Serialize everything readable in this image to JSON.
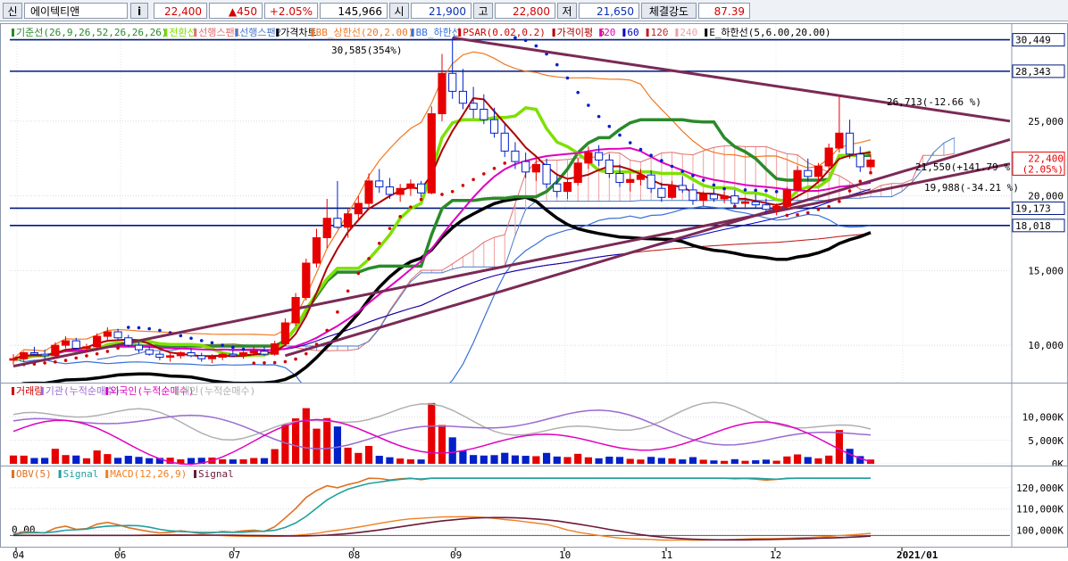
{
  "colors": {
    "up": "#e60000",
    "down": "#0020c8",
    "axis_line": "#001a80",
    "trend": "#7a2a55",
    "box_fill": "#ffffff",
    "box_stroke": "#001a80"
  },
  "toolbar": {
    "icon_left": "신",
    "stock_name": "에이텍티앤",
    "info_icon": "i",
    "price": "22,400",
    "change": "▲450",
    "change_pct": "+2.05%",
    "volume": "145,966",
    "open_label": "시",
    "open": "21,900",
    "high_label": "고",
    "high": "22,800",
    "low_label": "저",
    "low": "21,650",
    "strength_label": "체결강도",
    "strength": "87.39"
  },
  "price_legend": [
    {
      "text": "기준선(26,9,26,52,26,26,26)",
      "color": "#2a8a2a"
    },
    {
      "text": "전환선",
      "color": "#7ee000"
    },
    {
      "text": "선행스팬1",
      "color": "#e07070"
    },
    {
      "text": "선행스팬2",
      "color": "#4a7ac8"
    },
    {
      "text": "가격차트",
      "color": "#000000"
    },
    {
      "text": "BB_상한선(20,2.00)",
      "color": "#f07820"
    },
    {
      "text": "BB_하한선",
      "color": "#3870d8"
    },
    {
      "text": "PSAR(0.02,0.2)",
      "color": "#d00000"
    },
    {
      "text": "가격이평 5",
      "color": "#b00000"
    },
    {
      "text": "20",
      "color": "#e000c0"
    },
    {
      "text": "60",
      "color": "#0000c0"
    },
    {
      "text": "120",
      "color": "#c02020"
    },
    {
      "text": "240",
      "color": "#f0a0a0"
    },
    {
      "text": "E_하한선(5,6.00,20.00)",
      "color": "#000000"
    }
  ],
  "volume_legend": [
    {
      "text": "거래량",
      "color": "#d00000"
    },
    {
      "text": "기관(누적순매수)",
      "color": "#9b6ad0"
    },
    {
      "text": "외국인(누적순매수)",
      "color": "#e000c0"
    },
    {
      "text": "개인(누적순매수)",
      "color": "#b0b0b0"
    }
  ],
  "obv_legend": [
    {
      "text": "OBV(5)",
      "color": "#e07020"
    },
    {
      "text": "Signal",
      "color": "#20a0a0"
    },
    {
      "text": "MACD(12,26,9)",
      "color": "#f08020"
    },
    {
      "text": "Signal",
      "color": "#6a1a3a"
    }
  ],
  "chart_data": [
    {
      "type": "candlestick",
      "name": "price",
      "x_labels": [
        "04",
        "06",
        "07",
        "08",
        "09",
        "10",
        "11",
        "12",
        "2021/01"
      ],
      "y_ticks": [
        {
          "v": 10000,
          "label": "10,000"
        },
        {
          "v": 15000,
          "label": "15,000"
        },
        {
          "v": 20000,
          "label": "20,000"
        },
        {
          "v": 25000,
          "label": "25,000"
        }
      ],
      "ylim": [
        7500,
        31500
      ],
      "horizontal_levels": [
        {
          "v": 30449,
          "label": "30,449"
        },
        {
          "v": 28343,
          "label": "28,343"
        },
        {
          "v": 19173,
          "label": "19,173"
        },
        {
          "v": 18018,
          "label": "18,018"
        }
      ],
      "current_price": {
        "v": 22400,
        "label": "22,400",
        "pct": "(2.05%)"
      },
      "annotations": [
        {
          "text": "30,585(354%)",
          "x": "08 end",
          "v": 30585
        },
        {
          "text": "26,713(-12.66 %)",
          "x": "12 end",
          "v": 26713
        },
        {
          "text": "21,550(+141.79 %)",
          "x": "2021/01",
          "v": 21550
        },
        {
          "text": "19,988(-34.21 %)",
          "x": "2021/01",
          "v": 19988
        }
      ],
      "ohlc": [
        [
          9000,
          9400,
          8700,
          9100
        ],
        [
          9100,
          9600,
          8900,
          9500
        ],
        [
          9500,
          9900,
          9300,
          9400
        ],
        [
          9400,
          9700,
          9100,
          9300
        ],
        [
          9300,
          10200,
          9200,
          10000
        ],
        [
          10000,
          10600,
          9800,
          10300
        ],
        [
          10300,
          10500,
          9700,
          9800
        ],
        [
          9800,
          10100,
          9500,
          9900
        ],
        [
          9900,
          10800,
          9800,
          10600
        ],
        [
          10600,
          11200,
          10300,
          10900
        ],
        [
          10900,
          11100,
          10400,
          10500
        ],
        [
          10500,
          10700,
          9900,
          10000
        ],
        [
          10000,
          10200,
          9500,
          9700
        ],
        [
          9700,
          9900,
          9300,
          9400
        ],
        [
          9400,
          9600,
          9000,
          9200
        ],
        [
          9200,
          9500,
          8900,
          9300
        ],
        [
          9300,
          9600,
          9100,
          9500
        ],
        [
          9500,
          9800,
          9200,
          9300
        ],
        [
          9300,
          9500,
          8900,
          9100
        ],
        [
          9100,
          9400,
          8800,
          9200
        ],
        [
          9200,
          9500,
          9000,
          9400
        ],
        [
          9400,
          9700,
          9200,
          9300
        ],
        [
          9300,
          9600,
          9100,
          9500
        ],
        [
          9500,
          9900,
          9300,
          9600
        ],
        [
          9600,
          9900,
          9300,
          9400
        ],
        [
          9400,
          10300,
          9300,
          10100
        ],
        [
          10100,
          11800,
          10000,
          11500
        ],
        [
          11500,
          13500,
          11300,
          13200
        ],
        [
          13200,
          15800,
          13000,
          15500
        ],
        [
          15500,
          17800,
          15200,
          17200
        ],
        [
          17200,
          19800,
          16500,
          18500
        ],
        [
          18500,
          21000,
          17800,
          17900
        ],
        [
          17900,
          19200,
          17200,
          18800
        ],
        [
          18800,
          20000,
          18300,
          19500
        ],
        [
          19500,
          21500,
          19200,
          21000
        ],
        [
          21000,
          21800,
          20200,
          20600
        ],
        [
          20600,
          21200,
          19800,
          20100
        ],
        [
          20100,
          20800,
          19600,
          20500
        ],
        [
          20500,
          21100,
          20000,
          20800
        ],
        [
          20800,
          21000,
          19900,
          20200
        ],
        [
          20200,
          26000,
          20100,
          25500
        ],
        [
          25500,
          29500,
          25000,
          28200
        ],
        [
          28200,
          30585,
          26500,
          27000
        ],
        [
          27000,
          28500,
          25800,
          26200
        ],
        [
          26200,
          27300,
          25200,
          25800
        ],
        [
          25800,
          26800,
          24800,
          25100
        ],
        [
          25100,
          25900,
          23900,
          24200
        ],
        [
          24200,
          24800,
          22600,
          23000
        ],
        [
          23000,
          23600,
          21800,
          22300
        ],
        [
          22300,
          22900,
          21200,
          21600
        ],
        [
          21600,
          22600,
          21000,
          22100
        ],
        [
          22100,
          22500,
          20500,
          20800
        ],
        [
          20800,
          21400,
          19900,
          20300
        ],
        [
          20300,
          21200,
          19800,
          20900
        ],
        [
          20900,
          22500,
          20700,
          22200
        ],
        [
          22200,
          23300,
          21800,
          22900
        ],
        [
          22900,
          23400,
          22000,
          22400
        ],
        [
          22400,
          22800,
          21200,
          21500
        ],
        [
          21500,
          22100,
          20600,
          20900
        ],
        [
          20900,
          21500,
          20300,
          21100
        ],
        [
          21100,
          21800,
          20700,
          21400
        ],
        [
          21400,
          21700,
          20200,
          20500
        ],
        [
          20500,
          20900,
          19600,
          19900
        ],
        [
          19900,
          21000,
          19800,
          20700
        ],
        [
          20700,
          21300,
          20200,
          20400
        ],
        [
          20400,
          20800,
          19400,
          19700
        ],
        [
          19700,
          20300,
          19300,
          20100
        ],
        [
          20100,
          20500,
          19600,
          19800
        ],
        [
          19800,
          20300,
          19500,
          20000
        ],
        [
          20000,
          20400,
          19300,
          19500
        ],
        [
          19500,
          19900,
          19100,
          19600
        ],
        [
          19600,
          20100,
          19200,
          19400
        ],
        [
          19400,
          19800,
          18800,
          19100
        ],
        [
          19100,
          19500,
          18700,
          19300
        ],
        [
          19300,
          20600,
          19200,
          20400
        ],
        [
          20400,
          22000,
          20300,
          21700
        ],
        [
          21700,
          22500,
          21000,
          21300
        ],
        [
          21300,
          22200,
          20900,
          22000
        ],
        [
          22000,
          23500,
          21800,
          23200
        ],
        [
          23200,
          26713,
          22900,
          24200
        ],
        [
          24200,
          25100,
          22500,
          22800
        ],
        [
          22800,
          23300,
          21600,
          21950
        ],
        [
          21950,
          22800,
          21650,
          22400
        ]
      ]
    },
    {
      "type": "bar",
      "name": "volume",
      "y_ticks": [
        {
          "v": 0,
          "label": "0K"
        },
        {
          "v": 5000,
          "label": "5,000K"
        },
        {
          "v": 10000,
          "label": "10,000K"
        }
      ],
      "ylim": [
        0,
        14500
      ]
    },
    {
      "type": "line",
      "name": "obv_macd",
      "y_ticks": [
        {
          "v": 100000,
          "label": "100,000K"
        },
        {
          "v": 110000,
          "label": "110,000K"
        },
        {
          "v": 120000,
          "label": "120,000K"
        }
      ],
      "ylim": [
        93000,
        125000
      ],
      "zero_label": "0.00"
    }
  ]
}
